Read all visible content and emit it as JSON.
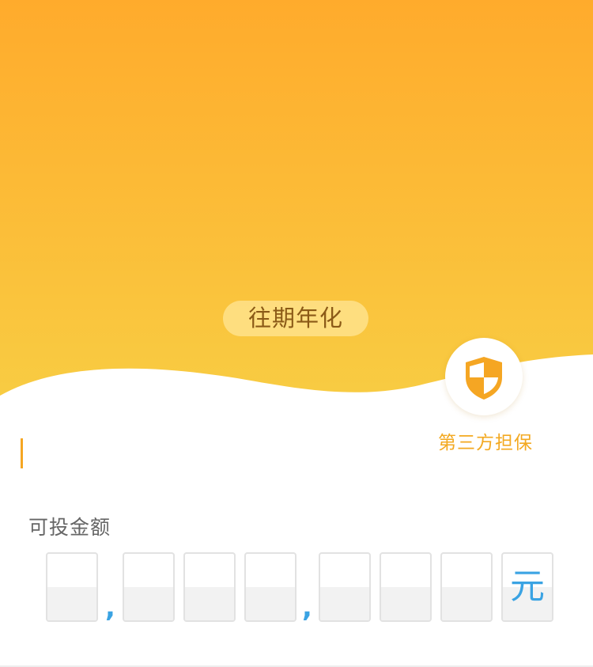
{
  "hero": {
    "gradient_top": "#ffab2c",
    "gradient_bottom": "#f8cd43",
    "annual_tag": "往期年化"
  },
  "guarantee": {
    "icon": "shield-icon",
    "label": "第三方担保",
    "accent_color": "#f3a921"
  },
  "amount": {
    "label": "可投金额",
    "digits": [
      "",
      "",
      "",
      "",
      "",
      "",
      ""
    ],
    "separators": [
      ",",
      ","
    ],
    "unit": "元",
    "digit_color": "#3aa3e3"
  }
}
